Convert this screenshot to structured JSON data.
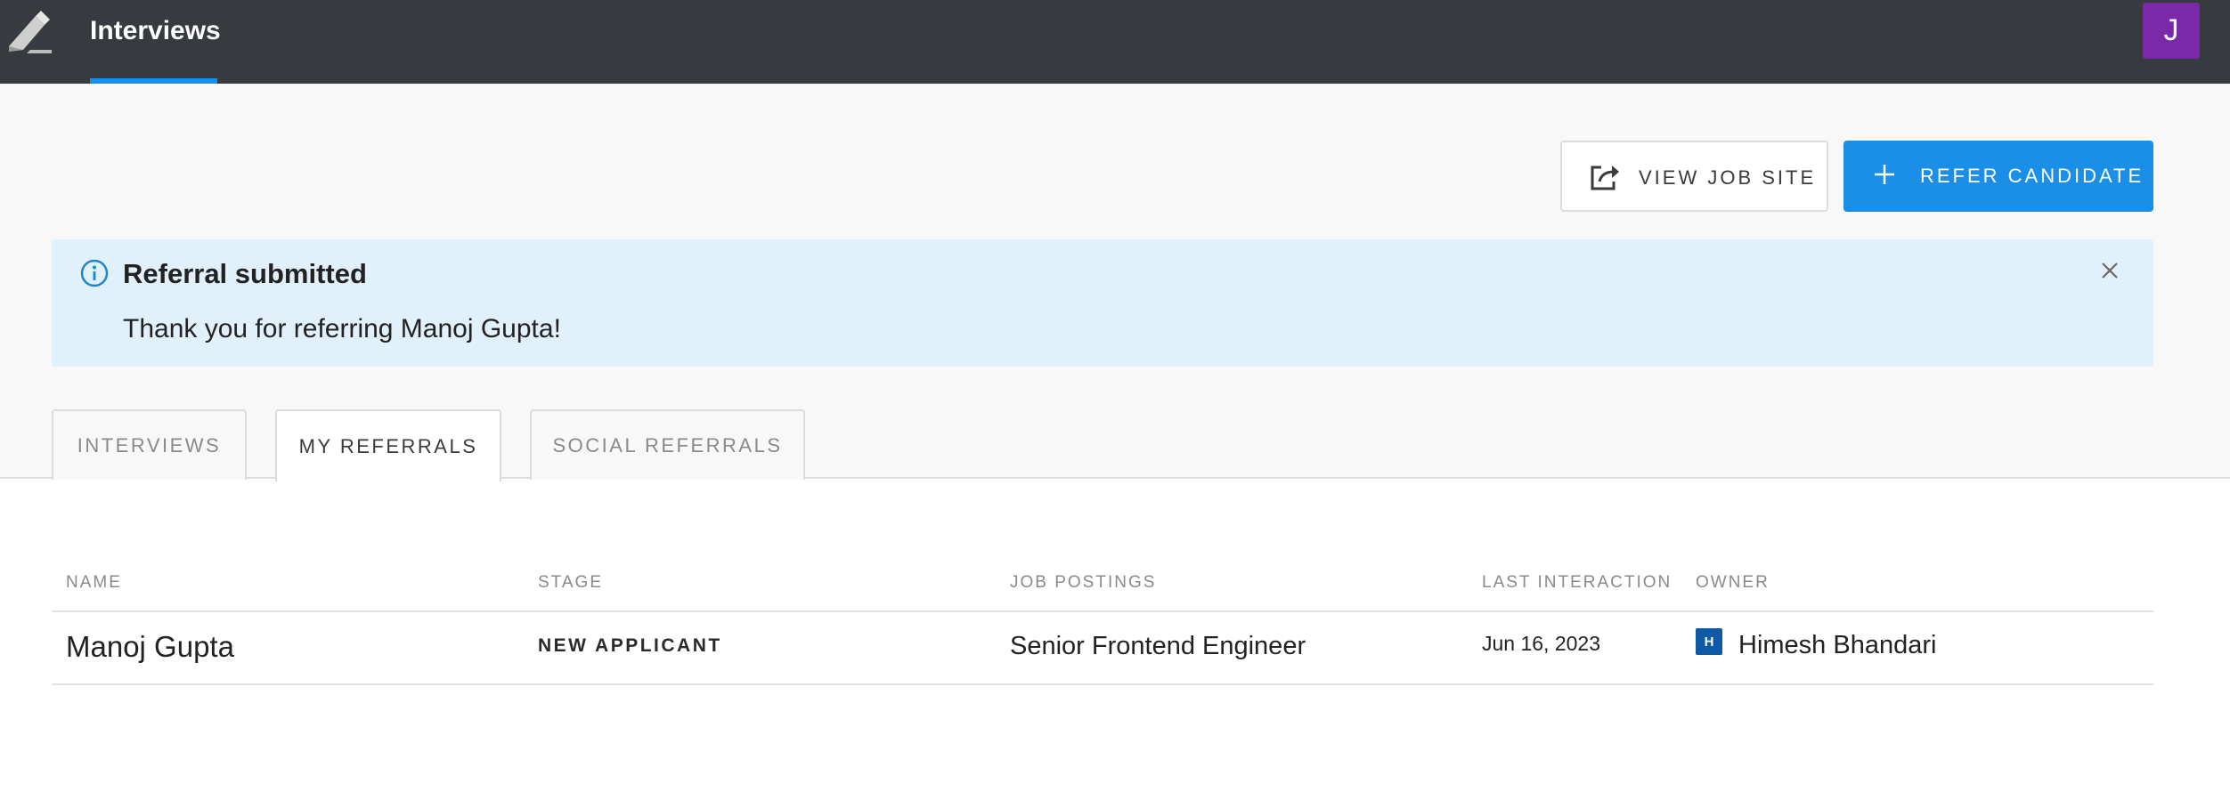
{
  "nav": {
    "logo_icon": "pencil-logo-icon",
    "active_tab": "Interviews",
    "avatar_initial": "J",
    "avatar_color": "#7a2aa8",
    "accent_color": "#1b8fe8"
  },
  "actions": {
    "view_job_site_label": "VIEW JOB SITE",
    "view_job_site_icon": "share-icon",
    "refer_candidate_label": "REFER CANDIDATE",
    "refer_candidate_icon": "plus-icon"
  },
  "alert": {
    "icon": "info-icon",
    "title": "Referral submitted",
    "message": "Thank you for referring Manoj Gupta!",
    "close_icon": "close-icon",
    "background": "#e1f1fc"
  },
  "tabs": [
    {
      "label": "INTERVIEWS",
      "active": false
    },
    {
      "label": "MY REFERRALS",
      "active": true
    },
    {
      "label": "SOCIAL REFERRALS",
      "active": false
    }
  ],
  "table": {
    "columns": [
      "NAME",
      "STAGE",
      "JOB POSTINGS",
      "LAST INTERACTION",
      "OWNER"
    ],
    "rows": [
      {
        "name": "Manoj Gupta",
        "stage": "NEW APPLICANT",
        "job_posting": "Senior Frontend Engineer",
        "last_interaction": "Jun 16, 2023",
        "owner_initial": "H",
        "owner": "Himesh Bhandari"
      }
    ]
  }
}
